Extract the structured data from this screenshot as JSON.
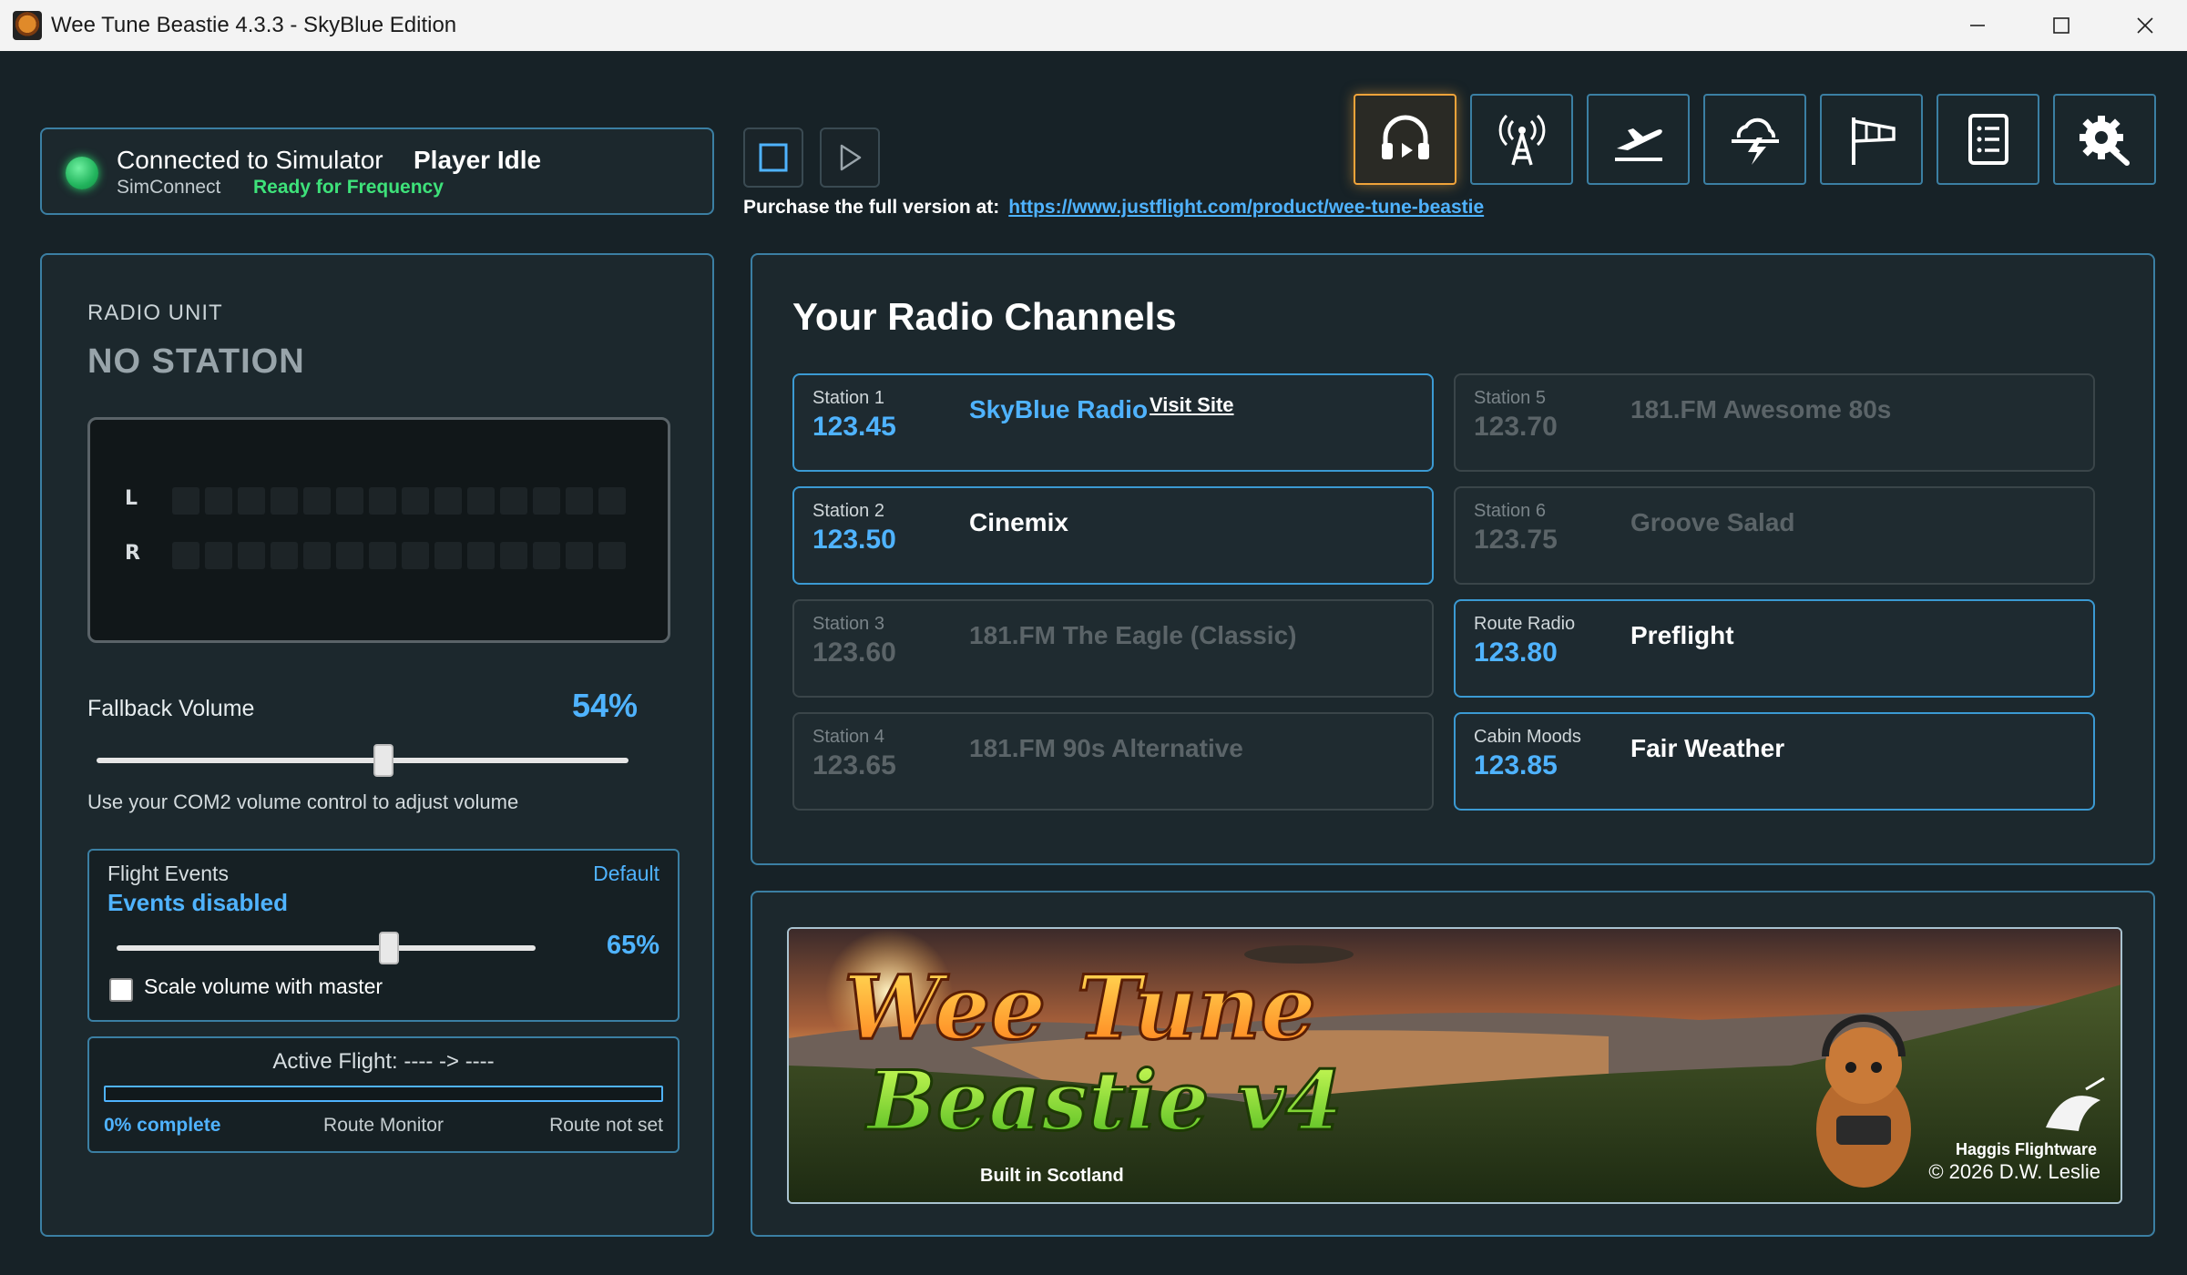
{
  "window": {
    "title": "Wee Tune Beastie 4.3.3 - SkyBlue Edition"
  },
  "status": {
    "connection": "Connected to Simulator",
    "player": "Player Idle",
    "source": "SimConnect",
    "ready": "Ready for Frequency"
  },
  "purchase": {
    "label": "Purchase the full version at:",
    "url": "https://www.justflight.com/product/wee-tune-beastie"
  },
  "toolbar": {
    "icons": [
      "headphones-play-icon",
      "radio-tower-icon",
      "takeoff-icon",
      "weather-icon",
      "windsock-icon",
      "checklist-icon",
      "settings-icon"
    ],
    "active": "headphones-play-icon"
  },
  "radio_unit": {
    "label": "RADIO UNIT",
    "station": "NO STATION",
    "left": "L",
    "right": "R",
    "fallback_label": "Fallback Volume",
    "fallback_value": "54%",
    "fallback_level": 0.54,
    "hint": "Use your COM2 volume control to adjust volume"
  },
  "events": {
    "title": "Flight Events",
    "default_label": "Default",
    "status": "Events disabled",
    "value": "65%",
    "level": 0.65,
    "scale_label": "Scale volume with master",
    "scale_checked": false
  },
  "flight": {
    "title": "Active Flight: ---- -> ----",
    "percent": "0% complete",
    "progress": 0,
    "monitor": "Route Monitor",
    "route": "Route not set"
  },
  "channels": {
    "title": "Your Radio Channels",
    "visit_label": "Visit Site",
    "items": [
      {
        "label": "Station 1",
        "freq": "123.45",
        "name": "SkyBlue Radio",
        "active": true
      },
      {
        "label": "Station 2",
        "freq": "123.50",
        "name": "Cinemix",
        "active": true
      },
      {
        "label": "Station 3",
        "freq": "123.60",
        "name": "181.FM The Eagle (Classic)",
        "active": false
      },
      {
        "label": "Station 4",
        "freq": "123.65",
        "name": "181.FM 90s Alternative",
        "active": false
      },
      {
        "label": "Station 5",
        "freq": "123.70",
        "name": "181.FM Awesome 80s",
        "active": false
      },
      {
        "label": "Station 6",
        "freq": "123.75",
        "name": "Groove Salad",
        "active": false
      },
      {
        "label": "Route Radio",
        "freq": "123.80",
        "name": "Preflight",
        "active": true
      },
      {
        "label": "Cabin Moods",
        "freq": "123.85",
        "name": "Fair Weather",
        "active": true
      }
    ]
  },
  "banner": {
    "logo_line1": "Wee Tune",
    "logo_line2": "Beastie v4",
    "built": "Built in Scotland",
    "company": "Haggis Flightware",
    "copyright": "© 2026 D.W. Leslie"
  },
  "colors": {
    "accent": "#4fb3ff",
    "border": "#3b7fa3",
    "active_tool": "#f0a33a",
    "connected": "#22b45d"
  }
}
